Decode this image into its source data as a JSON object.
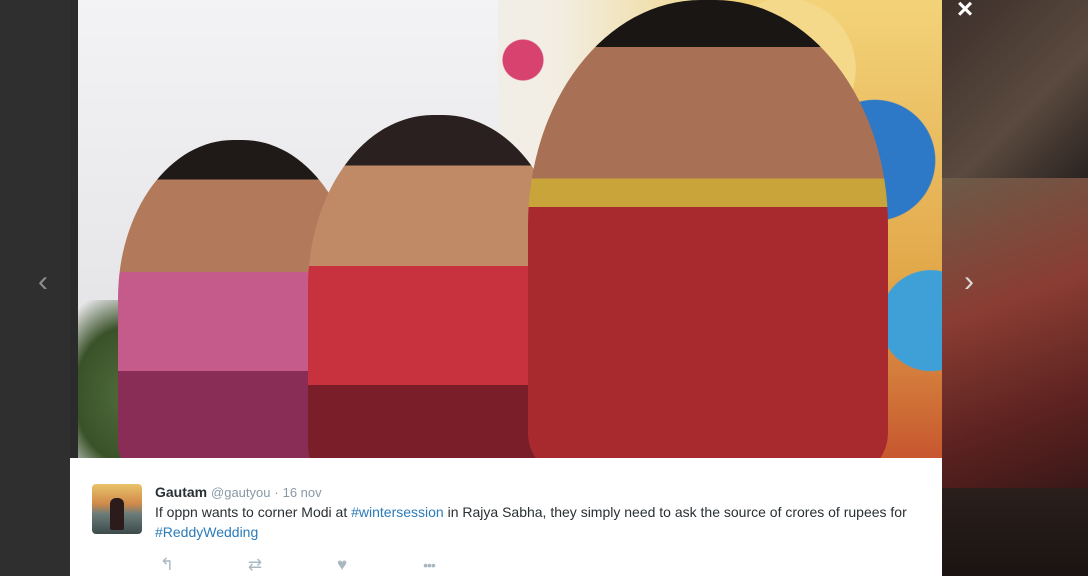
{
  "lightbox": {
    "close_icon": "close-icon",
    "prev_icon": "chevron-left-icon",
    "next_icon": "chevron-right-icon",
    "close_glyph": "×",
    "prev_glyph": "‹",
    "next_glyph": "›"
  },
  "tweet": {
    "author_name": "Gautam",
    "author_handle": "@gautyou",
    "separator": "·",
    "date": "16 nov",
    "text_part1": "If oppn wants to corner Modi at ",
    "hashtag1": "#wintersession",
    "text_part2": " in Rajya Sabha, they simply need to ask the source of crores of rupees for ",
    "hashtag2": "#ReddyWedding",
    "actions": {
      "reply_icon": "reply-icon",
      "retweet_icon": "retweet-icon",
      "like_icon": "heart-icon",
      "more_icon": "more-icon",
      "reply_glyph": "↰",
      "retweet_glyph": "⇄",
      "like_glyph": "♥",
      "more_glyph": "•••"
    }
  },
  "colors": {
    "link": "#2b7bb9",
    "text": "#292f33",
    "muted": "#8899a6",
    "action": "#aab8c2"
  }
}
